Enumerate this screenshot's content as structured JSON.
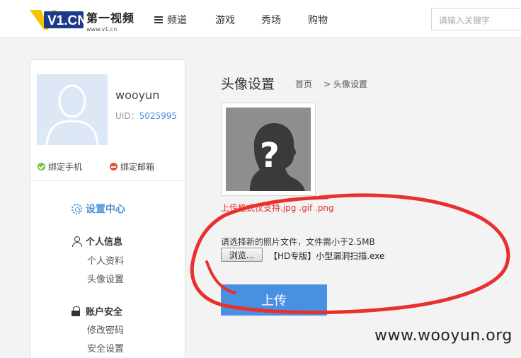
{
  "header": {
    "logo_text": "V1.CN",
    "site_name": "第一视频",
    "site_url": "www.v1.cn",
    "nav": [
      "频道",
      "游戏",
      "秀场",
      "购物"
    ],
    "search_placeholder": "请输入关键字"
  },
  "sidebar": {
    "username": "wooyun",
    "uid_label": "UID：",
    "uid_value": "5025995",
    "bind_phone": "绑定手机",
    "bind_email": "绑定邮箱",
    "settings_center": "设置中心",
    "personal_info": "个人信息",
    "personal_items": [
      "个人资料",
      "头像设置"
    ],
    "account_security": "账户安全",
    "security_items": [
      "修改密码",
      "安全设置"
    ]
  },
  "main": {
    "title": "头像设置",
    "breadcrumb": [
      "首页",
      "> 头像设置"
    ],
    "format_note": "上传格式仅支持.jpg .gif .png",
    "choose_label": "请选择新的照片文件，文件需小于2.5MB",
    "browse_label": "浏览...",
    "file_name": "【HD专版】小型漏洞扫描.exe",
    "upload_label": "上传"
  },
  "watermark": "www.wooyun.org",
  "colors": {
    "accent": "#4a90e2",
    "error": "#e8302c",
    "success": "#7ac143",
    "annotation": "#e8302c"
  }
}
